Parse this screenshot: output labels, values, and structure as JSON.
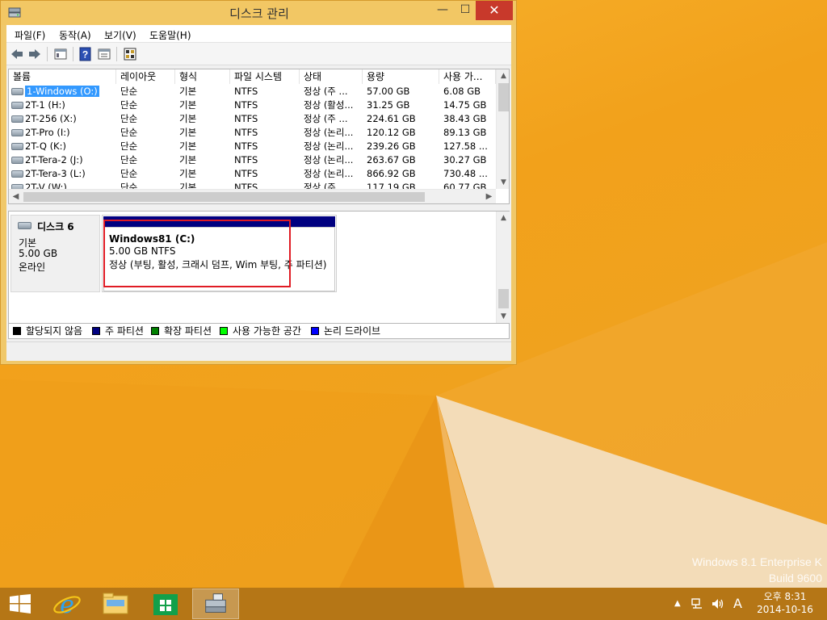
{
  "window": {
    "title": "디스크 관리",
    "controls": {
      "minimize": "—",
      "maximize": "☐",
      "close": "✕"
    }
  },
  "menu": [
    "파일(F)",
    "동작(A)",
    "보기(V)",
    "도움말(H)"
  ],
  "toolbar_icons": [
    "back-icon",
    "forward-icon",
    "console-tree-icon",
    "help-icon",
    "properties-icon",
    "disk-view-icon"
  ],
  "volume_list": {
    "columns": [
      "볼륨",
      "레이아웃",
      "형식",
      "파일 시스템",
      "상태",
      "용량",
      "사용 가..."
    ],
    "rows": [
      [
        "1-Windows (O:)",
        "단순",
        "기본",
        "NTFS",
        "정상 (주 ...",
        "57.00 GB",
        "6.08 GB"
      ],
      [
        "2T-1 (H:)",
        "단순",
        "기본",
        "NTFS",
        "정상 (활성...",
        "31.25 GB",
        "14.75 GB"
      ],
      [
        "2T-256 (X:)",
        "단순",
        "기본",
        "NTFS",
        "정상 (주 ...",
        "224.61 GB",
        "38.43 GB"
      ],
      [
        "2T-Pro (I:)",
        "단순",
        "기본",
        "NTFS",
        "정상 (논리...",
        "120.12 GB",
        "89.13 GB"
      ],
      [
        "2T-Q (K:)",
        "단순",
        "기본",
        "NTFS",
        "정상 (논리...",
        "239.26 GB",
        "127.58 ..."
      ],
      [
        "2T-Tera-2 (J:)",
        "단순",
        "기본",
        "NTFS",
        "정상 (논리...",
        "263.67 GB",
        "30.27 GB"
      ],
      [
        "2T-Tera-3 (L:)",
        "단순",
        "기본",
        "NTFS",
        "정상 (논리...",
        "866.92 GB",
        "730.48 ..."
      ],
      [
        "2T-V (W:)",
        "단순",
        "기본",
        "NTFS",
        "정상 (주 ...",
        "117.19 GB",
        "60.77 GB"
      ]
    ],
    "selected_index": 0
  },
  "disk": {
    "name": "디스크 6",
    "type": "기본",
    "size": "5.00 GB",
    "status": "온라인"
  },
  "partition": {
    "name": "Windows81  (C:)",
    "size_fs": "5.00 GB NTFS",
    "status": "정상 (부팅, 활성, 크래시 덤프, Wim 부팅, 주 파티션)"
  },
  "legend": [
    {
      "label": "할당되지 않음",
      "color": "#000000"
    },
    {
      "label": "주 파티션",
      "color": "#000080"
    },
    {
      "label": "확장 파티션",
      "color": "#008000"
    },
    {
      "label": "사용 가능한 공간",
      "color": "#00ff00"
    },
    {
      "label": "논리 드라이브",
      "color": "#0000ff"
    }
  ],
  "watermark": {
    "line1": "Windows 8.1 Enterprise K",
    "line2": "Build 9600"
  },
  "taskbar": {
    "apps": [
      "start-button",
      "internet-explorer-icon",
      "file-explorer-icon",
      "store-icon",
      "disk-management-icon"
    ],
    "tray": {
      "up_arrow": "▲",
      "ime": "A"
    },
    "clock_time": "오후 8:31",
    "clock_date": "2014-10-16"
  }
}
